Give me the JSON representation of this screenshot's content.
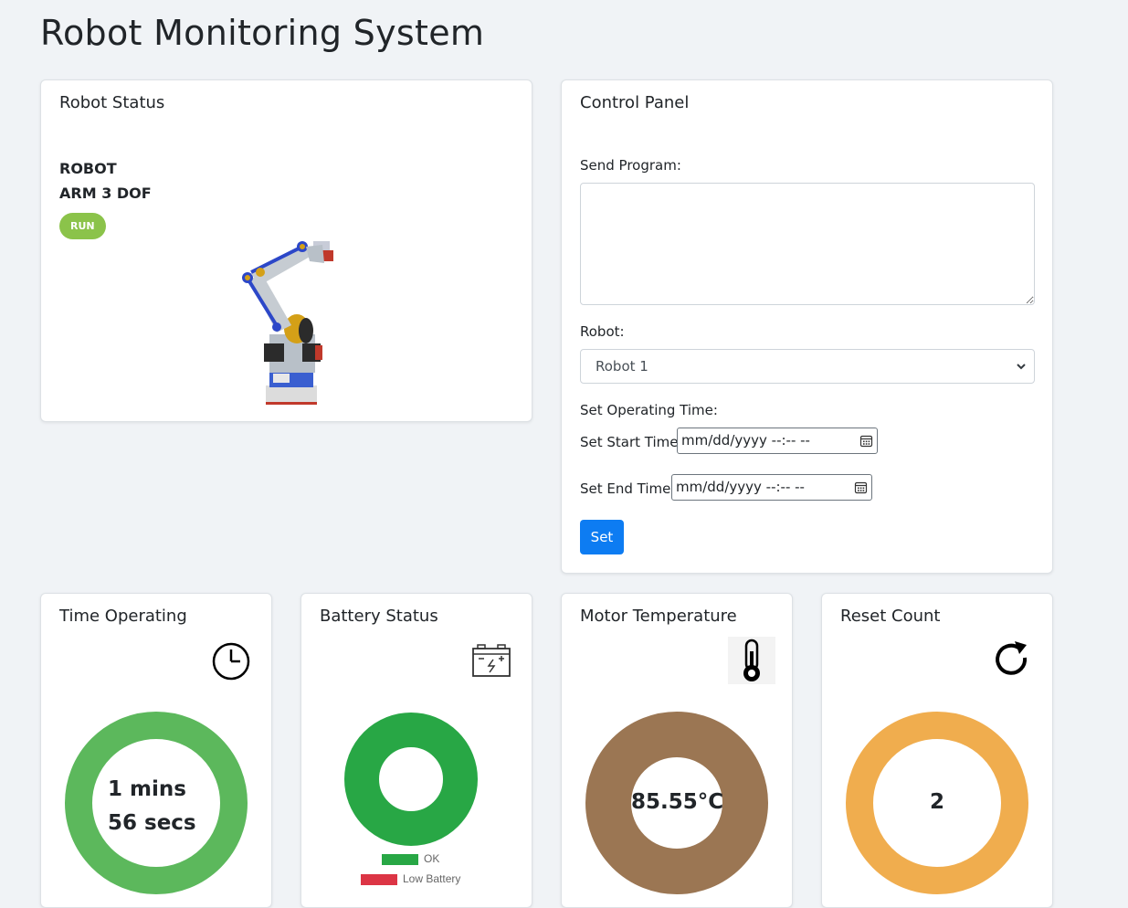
{
  "page": {
    "title": "Robot Monitoring System"
  },
  "robot_status": {
    "title": "Robot Status",
    "name_line1": "ROBOT",
    "name_line2": "ARM 3 DOF",
    "state_badge": "RUN"
  },
  "control_panel": {
    "title": "Control Panel",
    "send_program_label": "Send Program:",
    "program_value": "",
    "robot_label": "Robot:",
    "robot_selected": "Robot 1",
    "operating_time_label": "Set Operating Time:",
    "start_time_label": "Set Start Time:",
    "start_time_value": "mm/dd/yyyy --:-- --",
    "end_time_label": "Set End Time:",
    "end_time_value": "mm/dd/yyyy --:-- --",
    "set_button": "Set"
  },
  "time_operating": {
    "title": "Time Operating",
    "icon": "clock-icon",
    "line1": "1 mins",
    "line2": "56 secs",
    "color": "#5cb85c"
  },
  "battery_status": {
    "title": "Battery Status",
    "icon": "battery-icon",
    "legend_ok": "OK",
    "legend_low": "Low Battery",
    "ok_color": "#28a745",
    "low_color": "#dc3545"
  },
  "motor_temperature": {
    "title": "Motor Temperature",
    "icon": "thermometer-icon",
    "value": "85.55°C",
    "color": "#9b7653"
  },
  "reset_count": {
    "title": "Reset Count",
    "icon": "refresh-icon",
    "value": "2",
    "color": "#f0ad4e"
  }
}
